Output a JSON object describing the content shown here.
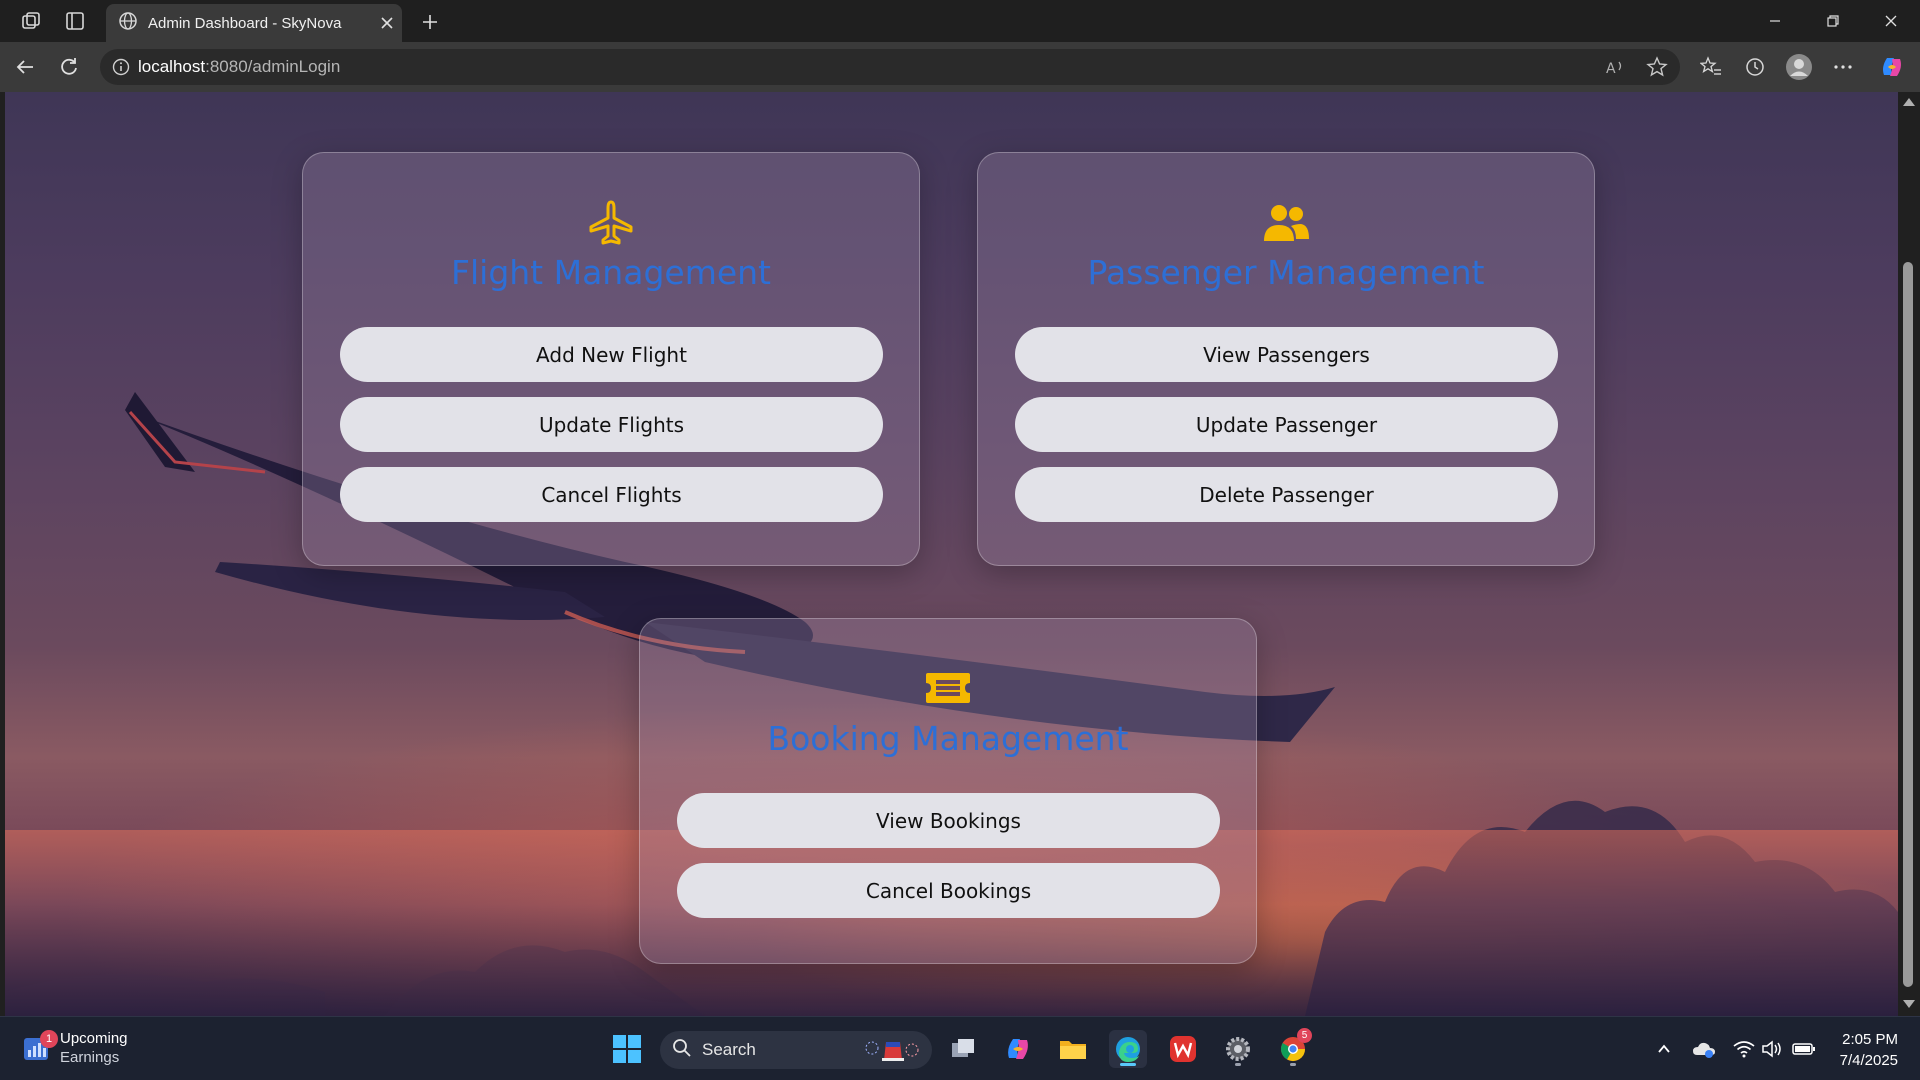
{
  "browser": {
    "tab_title": "Admin Dashboard - SkyNova",
    "url_host": "localhost",
    "url_rest": ":8080/adminLogin"
  },
  "page": {
    "cards": [
      {
        "icon": "airplane-icon",
        "title": "Flight Management",
        "buttons": [
          "Add New Flight",
          "Update Flights",
          "Cancel Flights"
        ]
      },
      {
        "icon": "users-icon",
        "title": "Passenger Management",
        "buttons": [
          "View Passengers",
          "Update Passenger",
          "Delete Passenger"
        ]
      },
      {
        "icon": "ticket-icon",
        "title": "Booking Management",
        "buttons": [
          "View Bookings",
          "Cancel Bookings"
        ]
      }
    ],
    "colors": {
      "title_blue": "#2d6fd6",
      "icon_yellow": "#f5b800",
      "button_bg": "#e2e2e8"
    }
  },
  "taskbar": {
    "widget_title": "Upcoming",
    "widget_sub": "Earnings",
    "widget_badge": "1",
    "search_placeholder": "Search",
    "chrome_badge": "5",
    "time": "2:05 PM",
    "date": "7/4/2025"
  }
}
